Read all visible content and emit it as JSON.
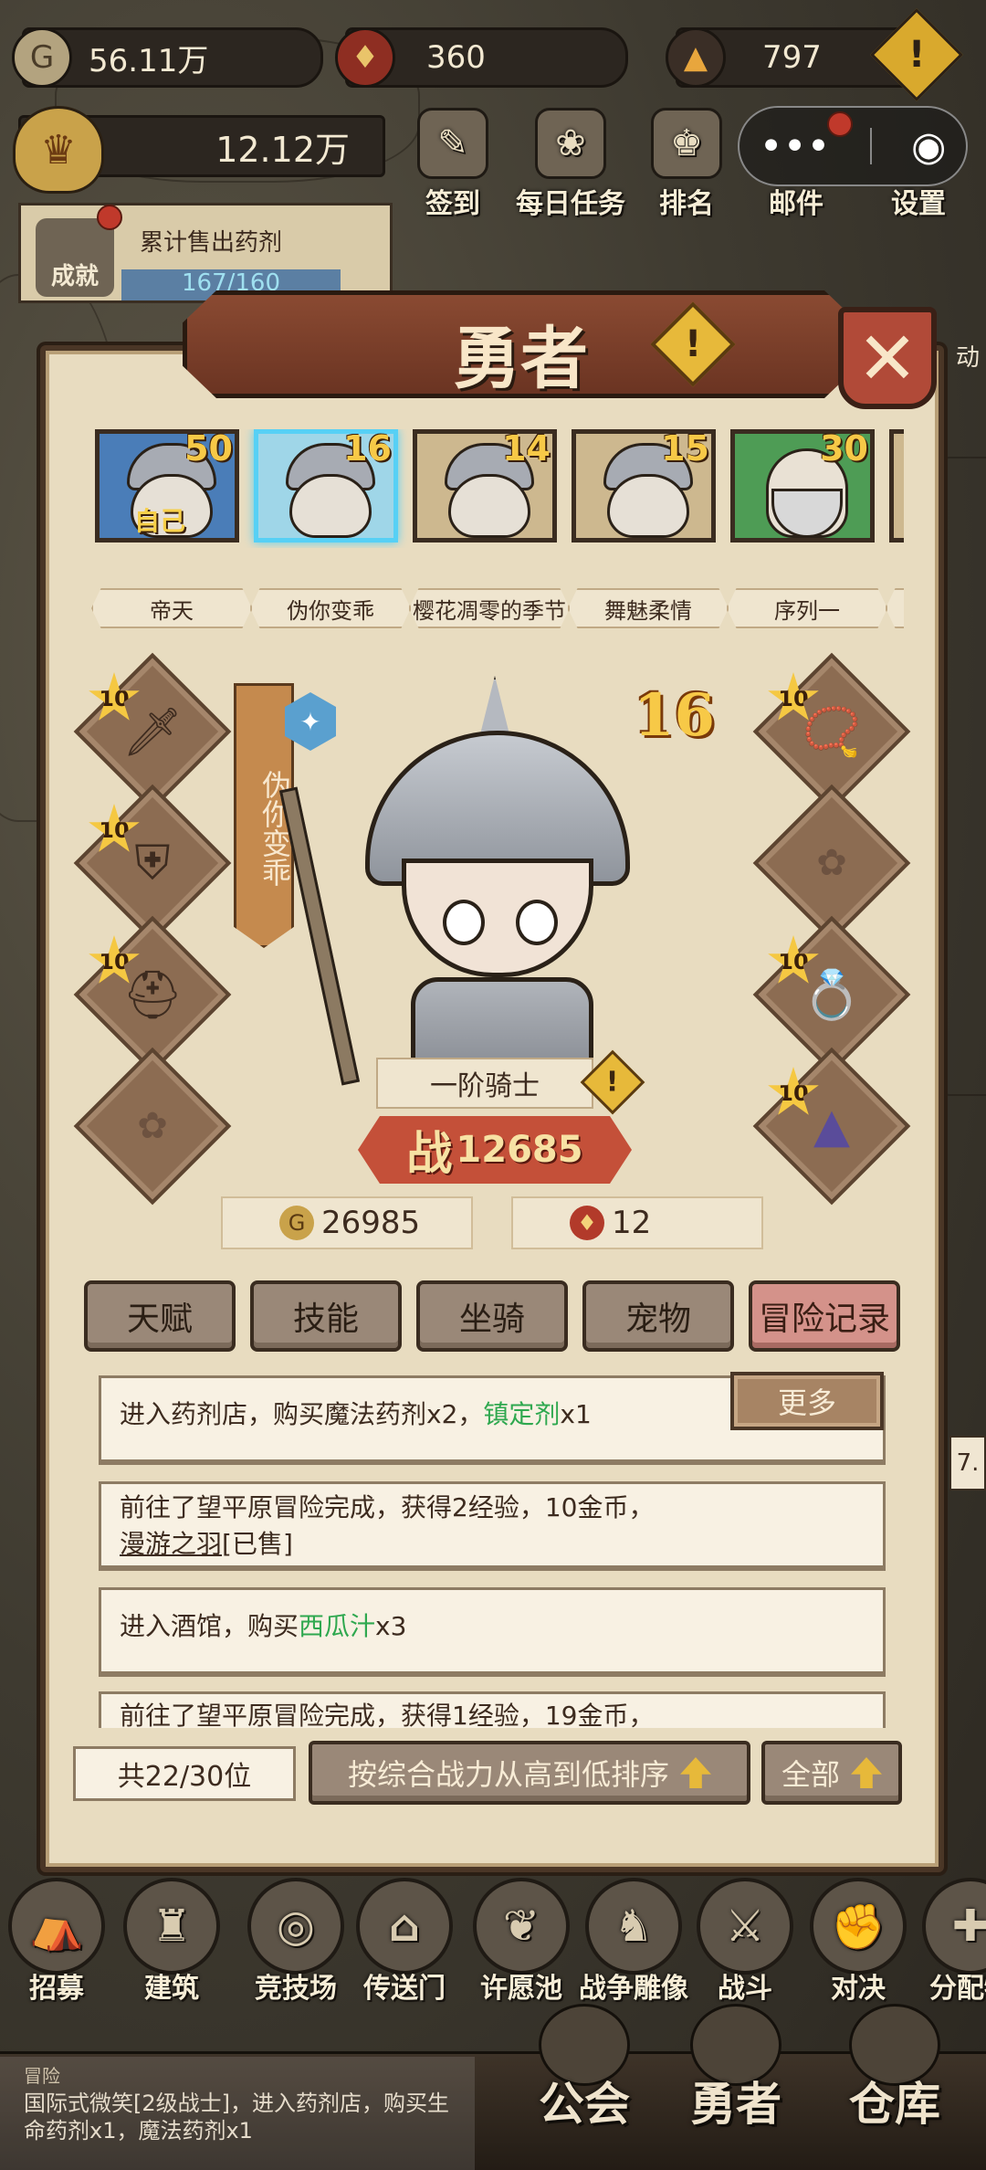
{
  "resources": {
    "gold": "56.11万",
    "shield": "360",
    "gems": "797",
    "power": "12.12万"
  },
  "top_menu": [
    {
      "label": "签到"
    },
    {
      "label": "每日任务"
    },
    {
      "label": "排名"
    },
    {
      "label": "邮件"
    },
    {
      "label": "设置"
    }
  ],
  "capsule": {
    "more": "•••",
    "close": "◉"
  },
  "achievement": {
    "label": "累计售出药剂",
    "progress": "167/160",
    "icon_label": "成就"
  },
  "panel": {
    "title": "勇者",
    "close": "✕"
  },
  "heroes": [
    {
      "name": "帝天",
      "level": "50",
      "tag": "自己"
    },
    {
      "name": "伪你变乖",
      "level": "16"
    },
    {
      "name": "樱花凋零的季节",
      "level": "14"
    },
    {
      "name": "舞魅柔情",
      "level": "15"
    },
    {
      "name": "序列一",
      "level": "30"
    }
  ],
  "equipment": {
    "left": [
      {
        "star": "10",
        "icon": "sword-icon"
      },
      {
        "star": "10",
        "icon": "armor-icon"
      },
      {
        "star": "10",
        "icon": "helmet-icon"
      },
      {
        "star": "",
        "icon": "empty-slot"
      }
    ],
    "right": [
      {
        "star": "10",
        "icon": "necklace-icon"
      },
      {
        "star": "",
        "icon": "empty-slot"
      },
      {
        "star": "10",
        "icon": "ring-icon"
      },
      {
        "star": "10",
        "icon": "cape-icon"
      }
    ]
  },
  "selected_hero": {
    "name": "伪你变乖",
    "level": "16",
    "class": "一阶骑士",
    "power_label": "战",
    "power": "12685",
    "gold": "26985",
    "tickets": "12"
  },
  "tabs": [
    {
      "label": "天赋"
    },
    {
      "label": "技能"
    },
    {
      "label": "坐骑"
    },
    {
      "label": "宠物"
    },
    {
      "label": "冒险记录"
    }
  ],
  "more_button": "更多",
  "logs": {
    "l1": {
      "a": "进入药剂店，购买魔法药剂x2，",
      "b": "镇定剂",
      "c": "x1"
    },
    "l2": {
      "a": "前往了望平原冒险完成，获得2经验，10金币，",
      "b": "漫游之羽",
      "c": "[已售]"
    },
    "l3": {
      "a": "进入酒馆，购买",
      "b": "西瓜汁",
      "c": "x3"
    },
    "l4": {
      "a": "前往了望平原冒险完成，获得1经验，19金币，"
    }
  },
  "footer": {
    "count": "共22/30位",
    "sort": "按综合战力从高到低排序",
    "filter": "全部"
  },
  "nav": [
    {
      "label": "招募"
    },
    {
      "label": "建筑"
    },
    {
      "label": "竞技场"
    },
    {
      "label": "传送门"
    },
    {
      "label": "许愿池"
    },
    {
      "label": "战争雕像"
    },
    {
      "label": "战斗"
    },
    {
      "label": "对决"
    },
    {
      "label": "分配物"
    }
  ],
  "adventure": {
    "label": "冒险",
    "text": "国际式微笑[2级战士]，进入药剂店，购买生命药剂x1，魔法药剂x1"
  },
  "bottom_nav": [
    {
      "label": "公会"
    },
    {
      "label": "勇者"
    },
    {
      "label": "仓库"
    }
  ],
  "edge_text": {
    "a": "动",
    "b": "7."
  }
}
